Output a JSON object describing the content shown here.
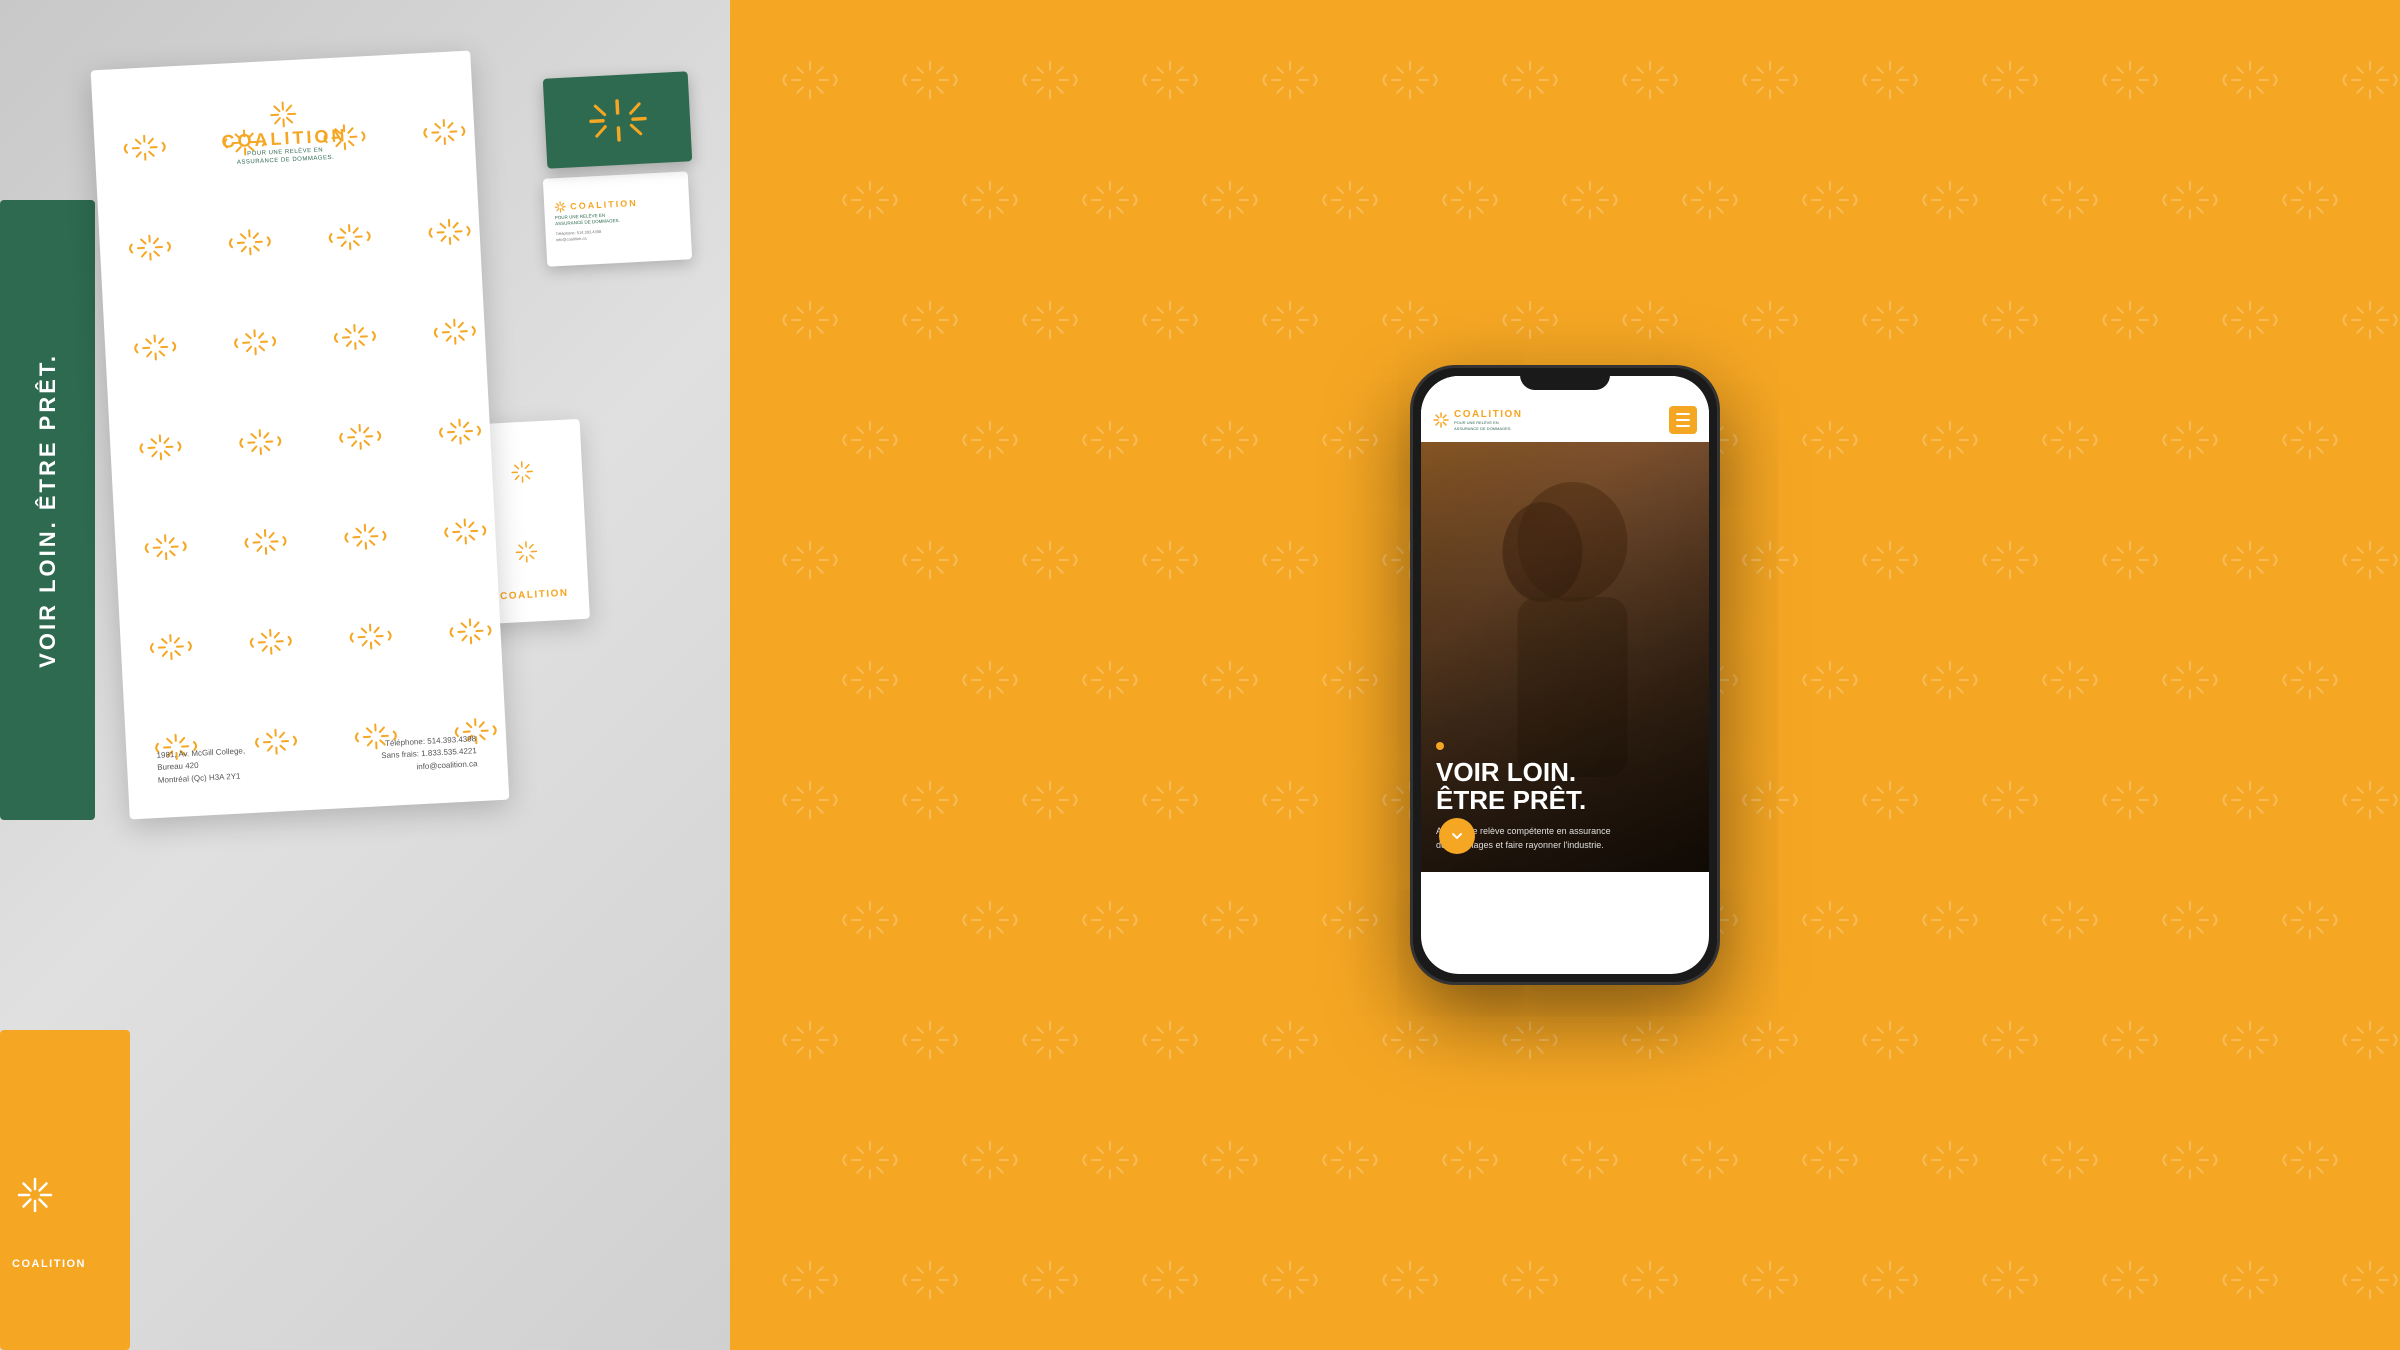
{
  "leftPanel": {
    "bgColor": "#d0d0d0",
    "greenCardText": "VOIR LOIN. ÊTRE PRÊT.",
    "greenCardColor": "#2D6A4F",
    "orangeCardColor": "#F5A623"
  },
  "rightPanel": {
    "bgColor": "#F5A623",
    "patternColor": "#E8940A"
  },
  "brand": {
    "name": "COALITION",
    "tagline": "POUR UNE RELÈVE EN\nASSURANCE DE DOMMAGES.",
    "color": "#F5A623",
    "green": "#2D6A4F"
  },
  "letterhead": {
    "address": "1981, Av. McGill College,\nBureau 420\nMontréal (Qc) H3A 2Y1",
    "phone": "Téléphone: 514.393.4398",
    "tollfree": "Sans frais: 1.833.535.4221",
    "email": "info@coalition.ca"
  },
  "phone": {
    "header": {
      "logoText": "COALITION",
      "logoSub": "POUR UNE RELÈVE EN\nASSURANCE DE DOMMAGES.",
      "menuColor": "#F5A623"
    },
    "hero": {
      "headline1": "VOIR LOIN.",
      "headline2": "ÊTRE PRÊT.",
      "subtitle": "Attirer une relève compétente en assurance de dommages et faire rayonner l'industrie.",
      "dotColor": "#F5A623"
    }
  }
}
